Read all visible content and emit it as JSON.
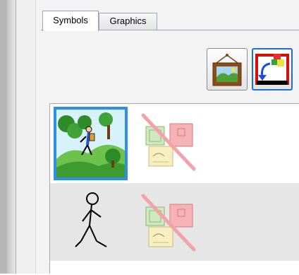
{
  "tabs": [
    {
      "label": "Symbols",
      "active": true
    },
    {
      "label": "Graphics",
      "active": false
    }
  ],
  "toolbar": {
    "buttons": [
      {
        "icon": "framed-picture-icon"
      },
      {
        "icon": "replace-symbol-icon"
      }
    ]
  },
  "symbol_list": {
    "rows": [
      {
        "symbol_icon": "hiking-landscape-icon",
        "selected": true,
        "graphic_icon": "no-graphic-icon"
      },
      {
        "symbol_icon": "walking-stick-figure-icon",
        "selected": false,
        "graphic_icon": "no-graphic-icon"
      }
    ]
  },
  "colors": {
    "selection_border": "#2f8fe8",
    "tab_border": "#9ba7b4",
    "row_alt_bg": "#e6e6e6"
  }
}
